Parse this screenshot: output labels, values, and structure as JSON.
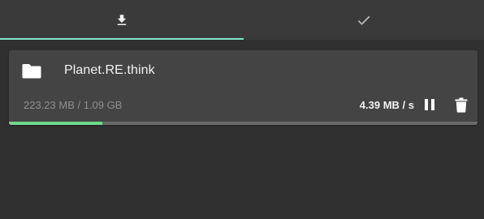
{
  "tabs": [
    {
      "icon": "download-icon",
      "active": true
    },
    {
      "icon": "check-icon",
      "active": false
    }
  ],
  "colors": {
    "accent": "#7fe3c6",
    "progress": "#6fd98a",
    "card_bg": "#444444",
    "page_bg": "#303030"
  },
  "download": {
    "icon": "folder-icon",
    "name": "Planet.RE.think",
    "size_progress": "223.23 MB / 1.09 GB",
    "speed": "4.39 MB / s",
    "progress_percent": 20,
    "pause_icon": "pause-icon",
    "delete_icon": "trash-icon"
  }
}
